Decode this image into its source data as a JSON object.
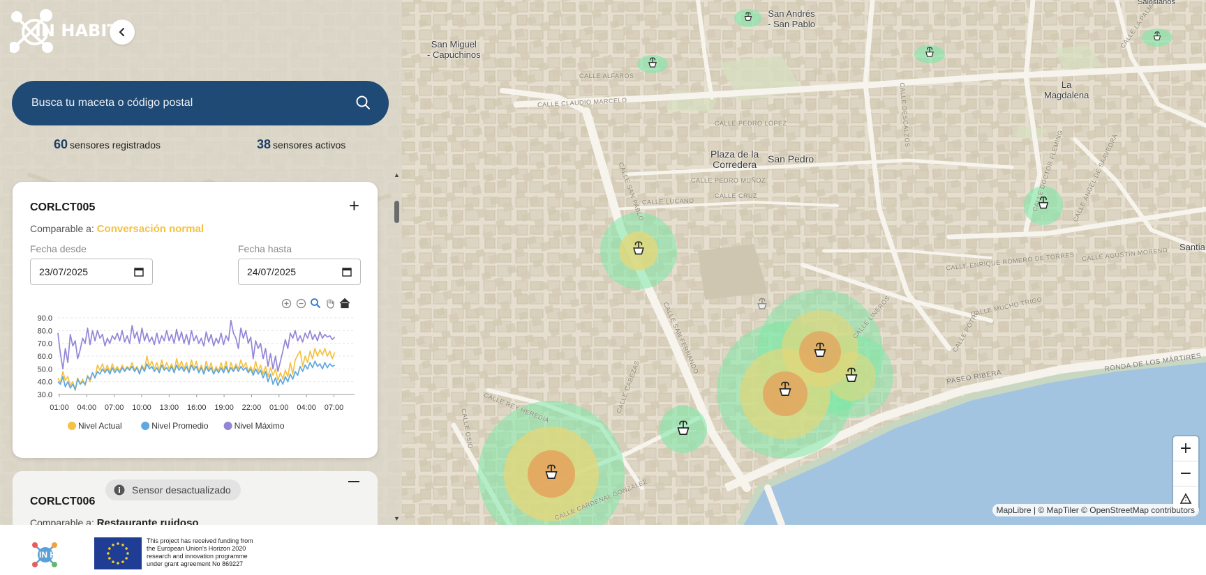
{
  "brand": {
    "logo_text": "IN HABIT"
  },
  "sidebar": {
    "search_placeholder": "Busca tu maceta o código postal",
    "stats": {
      "registered_count": "60",
      "registered_label": "sensores registrados",
      "active_count": "38",
      "active_label": "sensores activos"
    }
  },
  "card1": {
    "title": "CORLCT005",
    "comparable_label": "Comparable a:",
    "comparable_value": "Conversación normal",
    "comparable_color": "#f5c242",
    "date_from_label": "Fecha desde",
    "date_from_value": "23/07/2025",
    "date_to_label": "Fecha hasta",
    "date_to_value": "24/07/2025",
    "toolbar_icons": [
      "zoom-in-icon",
      "zoom-out-icon",
      "zoom-select-icon",
      "pan-hand-icon",
      "reset-home-icon"
    ]
  },
  "card2": {
    "title": "CORLCT006",
    "badge": "Sensor desactualizado",
    "comparable_label": "Comparable a:",
    "comparable_value": "Restaurante ruidoso"
  },
  "chart_data": {
    "type": "line",
    "title": "",
    "xlabel": "",
    "ylabel": "",
    "ylim": [
      30,
      90
    ],
    "y_ticks": [
      "90.0",
      "80.0",
      "70.0",
      "60.0",
      "50.0",
      "40.0",
      "30.0"
    ],
    "x_ticks": [
      "01:00",
      "04:00",
      "07:00",
      "10:00",
      "13:00",
      "16:00",
      "19:00",
      "22:00",
      "01:00",
      "04:00",
      "07:00"
    ],
    "legend_position": "bottom",
    "grid": true,
    "x": [
      0,
      1,
      2,
      3,
      4,
      5,
      6,
      7,
      8,
      9,
      10,
      11,
      12,
      13,
      14,
      15,
      16,
      17,
      18,
      19,
      20,
      21,
      22,
      23,
      24,
      25,
      26,
      27,
      28,
      29,
      30,
      31,
      32,
      33,
      34,
      35,
      36,
      37,
      38,
      39,
      40,
      41,
      42,
      43,
      44,
      45,
      46,
      47,
      48,
      49,
      50,
      51,
      52,
      53,
      54,
      55,
      56,
      57,
      58,
      59,
      60,
      61,
      62,
      63,
      64,
      65,
      66,
      67,
      68,
      69,
      70,
      71,
      72,
      73,
      74,
      75,
      76,
      77,
      78,
      79,
      80,
      81,
      82,
      83,
      84,
      85,
      86,
      87,
      88,
      89,
      90,
      91,
      92,
      93,
      94,
      95,
      96,
      97,
      98,
      99,
      100,
      101,
      102,
      103,
      104,
      105,
      106,
      107,
      108,
      109,
      110,
      111,
      112,
      113,
      114,
      115,
      116,
      117,
      118,
      119,
      120
    ],
    "series": [
      {
        "name": "Nivel Actual",
        "color": "#f5c242",
        "values": [
          43,
          39,
          48,
          41,
          44,
          37,
          40,
          33,
          43,
          38,
          42,
          37,
          45,
          40,
          47,
          43,
          53,
          49,
          54,
          48,
          53,
          47,
          54,
          49,
          52,
          48,
          53,
          49,
          52,
          50,
          55,
          49,
          52,
          47,
          53,
          49,
          60,
          52,
          56,
          50,
          55,
          49,
          57,
          50,
          55,
          50,
          54,
          48,
          58,
          51,
          56,
          50,
          55,
          48,
          57,
          50,
          56,
          48,
          53,
          47,
          56,
          49,
          55,
          46,
          52,
          48,
          55,
          48,
          56,
          47,
          55,
          49,
          54,
          50,
          57,
          51,
          55,
          48,
          52,
          47,
          56,
          48,
          53,
          46,
          52,
          44,
          51,
          45,
          50,
          41,
          47,
          42,
          49,
          44,
          55,
          46,
          57,
          61,
          64,
          52,
          60,
          55,
          64,
          58,
          66,
          60,
          65,
          61,
          66,
          60,
          64,
          58,
          63
        ]
      },
      {
        "name": "Nivel Promedio",
        "color": "#5fa8e0",
        "values": [
          40,
          38,
          44,
          36,
          40,
          35,
          38,
          34,
          42,
          38,
          40,
          38,
          44,
          42,
          47,
          43,
          48,
          46,
          50,
          47,
          50,
          46,
          51,
          47,
          50,
          47,
          51,
          48,
          51,
          49,
          52,
          48,
          51,
          46,
          52,
          48,
          54,
          50,
          52,
          48,
          51,
          47,
          53,
          49,
          51,
          48,
          52,
          47,
          53,
          49,
          52,
          48,
          52,
          47,
          53,
          49,
          52,
          47,
          51,
          46,
          52,
          48,
          51,
          46,
          50,
          47,
          51,
          47,
          52,
          47,
          51,
          48,
          52,
          48,
          52,
          49,
          51,
          47,
          50,
          45,
          50,
          46,
          49,
          43,
          48,
          40,
          46,
          38,
          43,
          37,
          42,
          38,
          44,
          40,
          46,
          42,
          48,
          45,
          52,
          48,
          53,
          50,
          55,
          51,
          56,
          52,
          54,
          50,
          55,
          51,
          54,
          52,
          53
        ]
      },
      {
        "name": "Nivel Máximo",
        "color": "#9585d8",
        "values": [
          78,
          62,
          50,
          66,
          55,
          77,
          68,
          72,
          58,
          65,
          74,
          70,
          82,
          69,
          80,
          72,
          80,
          74,
          77,
          68,
          74,
          70,
          76,
          73,
          78,
          72,
          80,
          71,
          76,
          70,
          84,
          74,
          79,
          70,
          82,
          72,
          78,
          71,
          75,
          69,
          78,
          70,
          76,
          72,
          80,
          72,
          77,
          70,
          81,
          72,
          79,
          70,
          77,
          69,
          80,
          72,
          76,
          70,
          74,
          68,
          79,
          71,
          77,
          68,
          74,
          70,
          78,
          69,
          76,
          72,
          88,
          78,
          74,
          66,
          82,
          74,
          80,
          70,
          75,
          58,
          72,
          66,
          70,
          58,
          66,
          52,
          62,
          50,
          60,
          48,
          56,
          64,
          73,
          66,
          78,
          74,
          80,
          72,
          76,
          71,
          78,
          74,
          80,
          73,
          77,
          72,
          79,
          74,
          77,
          75,
          76,
          73,
          75
        ]
      }
    ]
  },
  "map": {
    "places": [
      {
        "name": "San Andrés\n- San Pablo"
      },
      {
        "name": "San Miguel\n- Capuchinos"
      },
      {
        "name": "La\nMagdalena"
      },
      {
        "name": "Plaza de la\nCorredera"
      },
      {
        "name": "San Pedro"
      },
      {
        "name": "Santia"
      },
      {
        "name": "Salesianos"
      }
    ],
    "streets": [
      "CALLE CLAUDIO MARCELO",
      "CALLE SAN FERNANDO",
      "CALLE LUCANO",
      "PASEO RIBERA",
      "RONDA DE LOS MÁRTIRES",
      "CALLE CARDENAL GONZÁLEZ",
      "CALLE REY HEREDIA",
      "CALLE ALFAROS",
      "CALLE PEDRO LÓPEZ",
      "CALLE CRUZ",
      "CALLE PEDRO MUÑOZ",
      "CALLE LINEROS",
      "CALLE MUCHO TRIGO",
      "CALLE AGUSTÍN MORENO",
      "CALLE ENRIQUE ROMERO DE TORRES",
      "CALLE CABEZAS",
      "CALLE DESCALZOS",
      "CALLE SAN PABLO",
      "CALLE DOCTOR FLEMING",
      "CALLE LA PALMA",
      "CALLE ÁNGEL DE SAAVEDRA",
      "CALLE POTRO",
      "CALLE OSIO"
    ],
    "zoom_in": "+",
    "zoom_out": "−",
    "attribution": "MapLibre | © MapTiler © OpenStreetMap contributors"
  },
  "footer": {
    "logo_text": "IN HABIT",
    "eu_text": "This project has received funding from the European Union's Horizon 2020 research and innovation programme under grant agreement No 869227"
  }
}
